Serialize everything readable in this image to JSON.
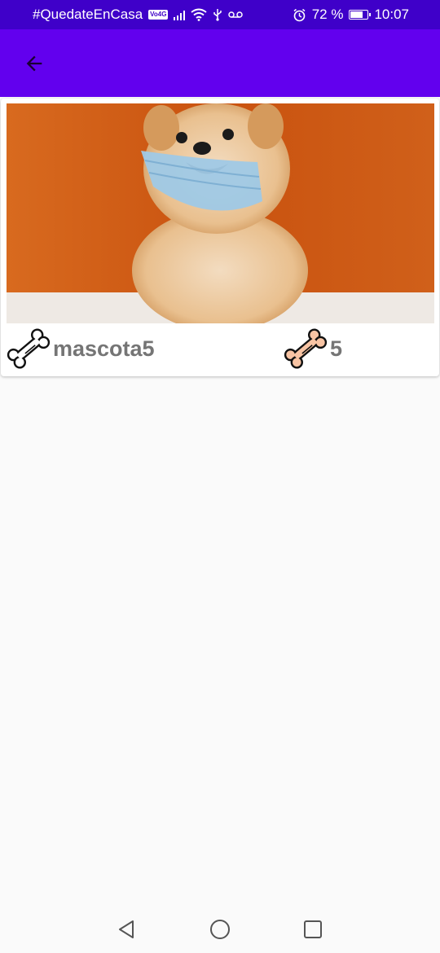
{
  "status_bar": {
    "hashtag": "#QuedateEnCasa",
    "volte_badge": "Vo4G",
    "battery_percent": "72 %",
    "battery_level": 0.72,
    "time": "10:07",
    "icons": [
      "signal-icon",
      "wifi-icon",
      "usb-icon",
      "voicemail-icon",
      "alarm-icon",
      "battery-icon"
    ]
  },
  "app_bar": {
    "background": "#6200ee",
    "back_icon": "arrow-back-icon"
  },
  "pet_card": {
    "image": "dog-with-face-mask-photo",
    "name": "mascota5",
    "value": "5",
    "name_icon": "bone-outline-icon",
    "value_icon": "bone-filled-icon",
    "value_icon_color": "#f8c4a4"
  },
  "nav_bar": {
    "buttons": [
      "back-triangle-icon",
      "home-circle-icon",
      "recents-square-icon"
    ]
  }
}
